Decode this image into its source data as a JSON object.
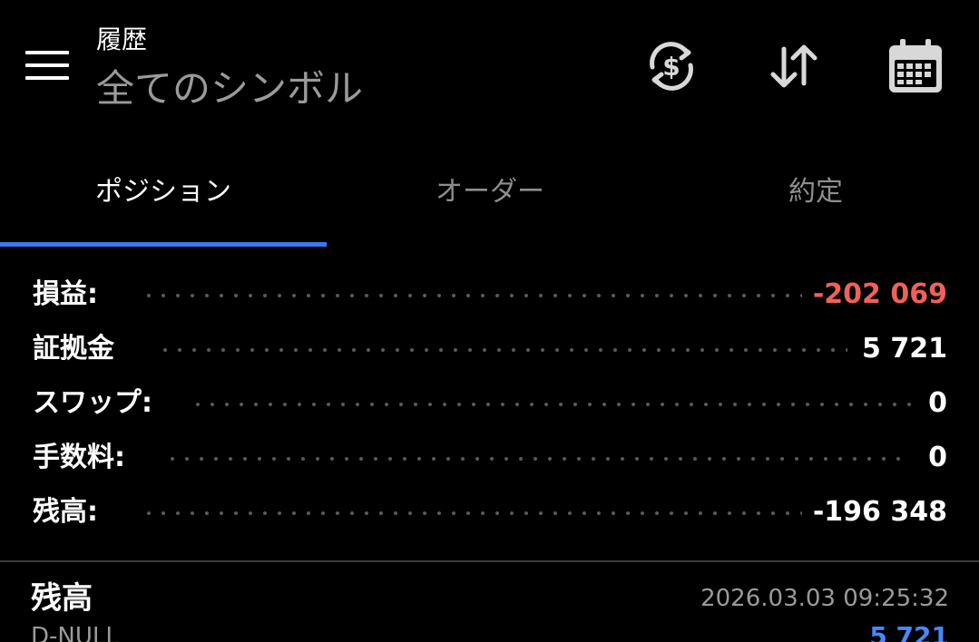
{
  "header": {
    "menu_icon": "hamburger-menu-icon",
    "title": "履歴",
    "subtitle": "全てのシンボル",
    "actions": [
      {
        "icon": "currency-exchange-icon"
      },
      {
        "icon": "sort-arrows-icon"
      },
      {
        "icon": "calendar-icon"
      }
    ]
  },
  "tabs": [
    {
      "label": "ポジション",
      "active": true
    },
    {
      "label": "オーダー",
      "active": false
    },
    {
      "label": "約定",
      "active": false
    }
  ],
  "summary": {
    "profit": {
      "label": "損益:",
      "value": "-202 069"
    },
    "margin": {
      "label": "証拠金",
      "value": "5 721"
    },
    "swap": {
      "label": "スワップ:",
      "value": "0"
    },
    "commission": {
      "label": "手数料:",
      "value": "0"
    },
    "balance": {
      "label": "残高:",
      "value": "-196 348"
    }
  },
  "history_entry": {
    "title": "残高",
    "datetime": "2026.03.03 09:25:32",
    "subtitle": "D-NULL",
    "amount": "5 721"
  },
  "colors": {
    "background": "#000000",
    "accent": "#3a78f2",
    "negative": "#f0615a",
    "positive_amount": "#4a86f7",
    "muted_text": "#9a9a9a"
  }
}
